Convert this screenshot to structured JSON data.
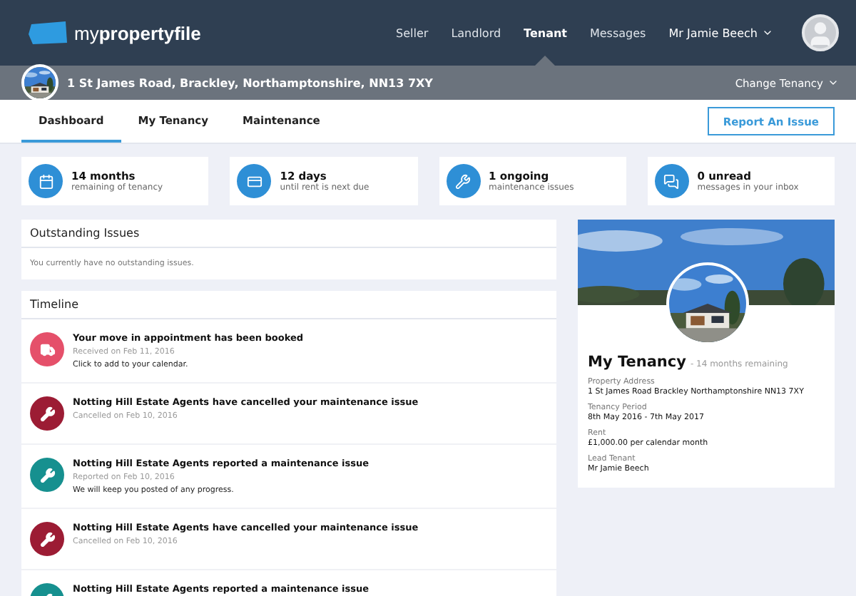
{
  "header": {
    "logo": {
      "light": "my",
      "bold": "propertyfile"
    },
    "nav": [
      {
        "label": "Seller",
        "selected": false
      },
      {
        "label": "Landlord",
        "selected": false
      },
      {
        "label": "Tenant",
        "selected": true
      },
      {
        "label": "Messages",
        "selected": false
      }
    ],
    "user": "Mr Jamie Beech"
  },
  "property_bar": {
    "address": "1 St James Road, Brackley, Northamptonshire, NN13 7XY",
    "switcher": "Change Tenancy"
  },
  "tabs": [
    {
      "label": "Dashboard",
      "selected": true
    },
    {
      "label": "My Tenancy",
      "selected": false
    },
    {
      "label": "Maintenance",
      "selected": false
    }
  ],
  "report_button": "Report An Issue",
  "stats": [
    {
      "kind": "calendar",
      "value": "14 months",
      "caption": "remaining of tenancy"
    },
    {
      "kind": "card",
      "value": "12 days",
      "caption": "until rent is next due"
    },
    {
      "kind": "wrench",
      "value": "1 ongoing",
      "caption": "maintenance issues"
    },
    {
      "kind": "messages",
      "value": "0 unread",
      "caption": "messages in your inbox"
    }
  ],
  "outstanding": {
    "title": "Outstanding Issues",
    "message": "You currently have no outstanding issues."
  },
  "timeline": {
    "title": "Timeline",
    "items": [
      {
        "kind": "move",
        "title": "Your move in appointment has been booked",
        "date": "Received on Feb 11, 2016",
        "note": "Click to add to your calendar."
      },
      {
        "kind": "cancelled",
        "title": "Notting Hill Estate Agents have cancelled your maintenance issue",
        "date": "Cancelled on Feb 10, 2016"
      },
      {
        "kind": "reported",
        "title": "Notting Hill Estate Agents reported a maintenance issue",
        "date": "Reported on Feb 10, 2016",
        "note": "We will keep you posted of any progress."
      },
      {
        "kind": "cancelled",
        "title": "Notting Hill Estate Agents have cancelled your maintenance issue",
        "date": "Cancelled on Feb 10, 2016"
      },
      {
        "kind": "reported",
        "title": "Notting Hill Estate Agents reported a maintenance issue"
      }
    ]
  },
  "tenancy": {
    "title": "My Tenancy",
    "subtitle": "- 14 months remaining",
    "fields": [
      {
        "label": "Property Address",
        "value": "1 St James Road Brackley Northamptonshire NN13 7XY"
      },
      {
        "label": "Tenancy Period",
        "value": "8th May 2016 - 7th May 2017"
      },
      {
        "label": "Rent",
        "value": "£1,000.00 per calendar month"
      },
      {
        "label": "Lead Tenant",
        "value": "Mr Jamie Beech"
      }
    ]
  }
}
